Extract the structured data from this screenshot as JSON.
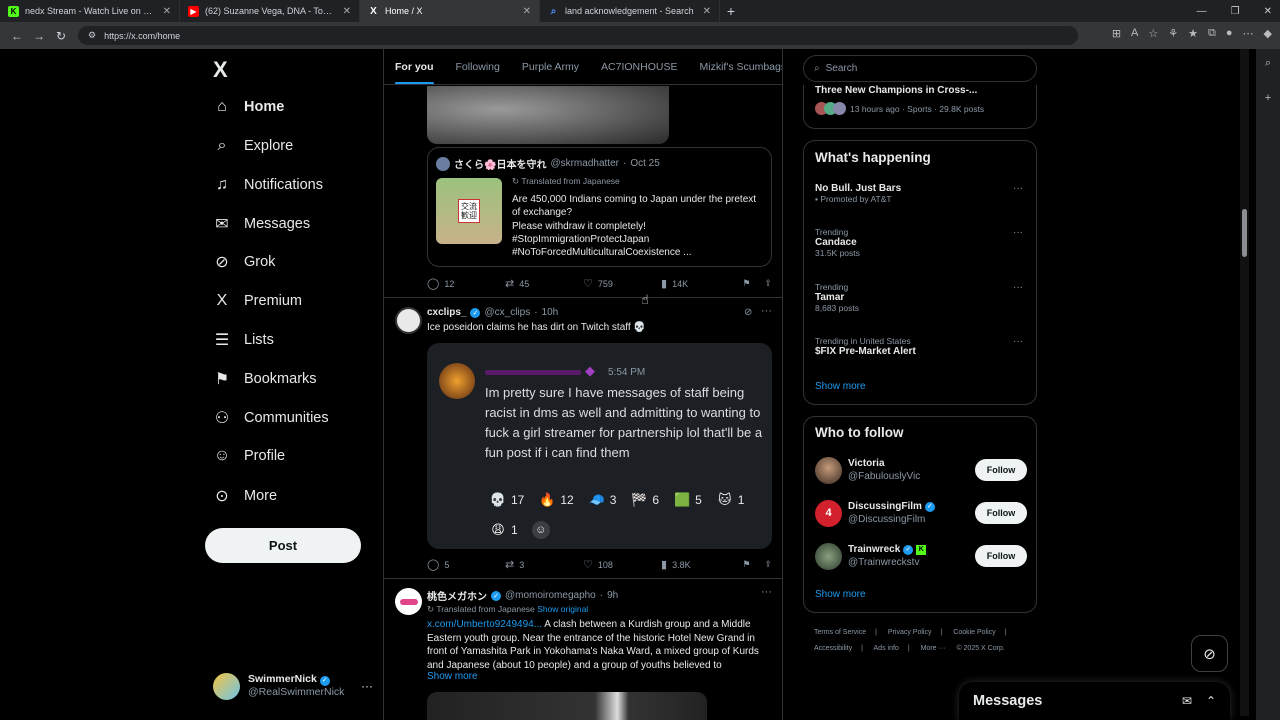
{
  "browser": {
    "tabs": [
      {
        "title": "nedx Stream - Watch Live on Kick",
        "icon": "K",
        "color": "#53fc18"
      },
      {
        "title": "(62) Suzanne Vega, DNA - Tom's D",
        "icon": "▶",
        "color": "#ff0000"
      },
      {
        "title": "Home / X",
        "icon": "X",
        "color": "#ffffff"
      },
      {
        "title": "land acknowledgement - Search",
        "icon": "⌕",
        "color": "#4f8ef7"
      }
    ],
    "url": "https://x.com/home"
  },
  "sidebar": {
    "logo": "X",
    "nav": [
      {
        "label": "Home",
        "icon": "⌂",
        "name": "home"
      },
      {
        "label": "Explore",
        "icon": "⌕",
        "name": "explore"
      },
      {
        "label": "Notifications",
        "icon": "🔔",
        "name": "notifications"
      },
      {
        "label": "Messages",
        "icon": "✉",
        "name": "messages"
      },
      {
        "label": "Grok",
        "icon": "⊘",
        "name": "grok"
      },
      {
        "label": "Premium",
        "icon": "X",
        "name": "premium"
      },
      {
        "label": "Lists",
        "icon": "☰",
        "name": "lists"
      },
      {
        "label": "Bookmarks",
        "icon": "⚑",
        "name": "bookmarks"
      },
      {
        "label": "Communities",
        "icon": "👥",
        "name": "communities"
      },
      {
        "label": "Profile",
        "icon": "👤",
        "name": "profile"
      },
      {
        "label": "More",
        "icon": "⋯",
        "name": "more"
      }
    ],
    "post_label": "Post",
    "account": {
      "name": "SwimmerNick",
      "handle": "@RealSwimmerNick"
    }
  },
  "feed_tabs": [
    "For you",
    "Following",
    "Purple Army",
    "AC7IONHOUSE",
    "Mizkif's Scumbags"
  ],
  "tweets": {
    "quoted": {
      "name": "さくら🌸日本を守れ",
      "handle": "@skrmadhatter",
      "time": "Oct 25",
      "translated": "Translated from Japanese",
      "text": "Are 450,000 Indians coming to Japan under the pretext of exchange?\nPlease withdraw it completely!\n#StopImmigrationProtectJapan\n#NoToForcedMulticulturalCoexistence ...",
      "img_text": "交流\n歓迎"
    },
    "quoted_actions": {
      "replies": "12",
      "reposts": "45",
      "likes": "759",
      "views": "14K"
    },
    "second": {
      "name": "cxclips_",
      "handle": "@cx_clips",
      "time": "10h",
      "text": "Ice poseidon claims he has dirt on Twitch staff 💀",
      "inner_time": "5:54 PM",
      "inner_text": "Im pretty sure I have messages of staff being racist in dms as well and admitting to wanting to fuck a girl streamer for partnership lol that'll be a fun post if i can find them",
      "reactions": [
        {
          "emoji": "💀",
          "count": "17"
        },
        {
          "emoji": "🔥",
          "count": "12"
        },
        {
          "emoji": "🧢",
          "count": "3"
        },
        {
          "emoji": "🏁",
          "count": "6"
        },
        {
          "emoji": "🟩",
          "count": "5"
        },
        {
          "emoji": "🐱",
          "count": "1"
        },
        {
          "emoji": "😩",
          "count": "1"
        }
      ],
      "actions": {
        "replies": "5",
        "reposts": "3",
        "likes": "108",
        "views": "3.8K"
      }
    },
    "third": {
      "name": "桃色メガホン",
      "handle": "@momoiromegapho",
      "time": "9h",
      "translated": "Translated from Japanese",
      "show_original": "Show original",
      "link": "x.com/Umberto9249494...",
      "text": " A clash between a Kurdish group and a Middle Eastern youth group. Near the entrance of the historic Hotel New Grand in front of Yamashita Park in Yokohama's Naka Ward, a mixed group of Kurds and Japanese (about 10 people) and a group of youths believed to",
      "show_more": "Show more"
    }
  },
  "right": {
    "search_placeholder": "Search",
    "top_trend": {
      "title": "Three New Champions in Cross-...",
      "meta": "13 hours ago · Sports · 29.8K posts"
    },
    "happening_title": "What's happening",
    "trends": [
      {
        "ctx": "Promoted by AT&T",
        "title": "No Bull. Just Bars",
        "posts": ""
      },
      {
        "ctx": "Trending",
        "title": "Candace",
        "posts": "31.5K posts"
      },
      {
        "ctx": "Trending",
        "title": "Tamar",
        "posts": "8,683 posts"
      },
      {
        "ctx": "Trending in United States",
        "title": "$FIX Pre-Market Alert",
        "posts": ""
      }
    ],
    "show_more": "Show more",
    "who_title": "Who to follow",
    "follow": [
      {
        "name": "Victoria",
        "handle": "@FabulouslyVic"
      },
      {
        "name": "DiscussingFilm",
        "handle": "@DiscussingFilm"
      },
      {
        "name": "Trainwreck",
        "handle": "@Trainwreckstv"
      }
    ],
    "follow_label": "Follow",
    "footer": [
      "Terms of Service",
      "|",
      "Privacy Policy",
      "|",
      "Cookie Policy",
      "|",
      "Accessibility",
      "|",
      "Ads info",
      "|",
      "More ···",
      "© 2025 X Corp."
    ]
  },
  "messages_drawer": "Messages"
}
